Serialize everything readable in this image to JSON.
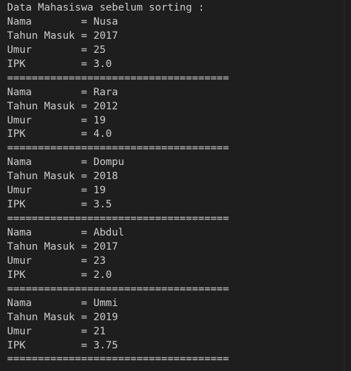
{
  "terminal": {
    "header": "Data Mahasiswa sebelum sorting :",
    "separator": "====================================",
    "labels": {
      "nama": "Nama        = ",
      "tahun": "Tahun Masuk = ",
      "umur": "Umur        = ",
      "ipk": "IPK         = "
    },
    "records": [
      {
        "nama": "Nusa",
        "tahun": "2017",
        "umur": "25",
        "ipk": "3.0"
      },
      {
        "nama": "Rara",
        "tahun": "2012",
        "umur": "19",
        "ipk": "4.0"
      },
      {
        "nama": "Dompu",
        "tahun": "2018",
        "umur": "19",
        "ipk": "3.5"
      },
      {
        "nama": "Abdul",
        "tahun": "2017",
        "umur": "23",
        "ipk": "2.0"
      },
      {
        "nama": "Ummi",
        "tahun": "2019",
        "umur": "21",
        "ipk": "3.75"
      }
    ],
    "colors": {
      "background": "#1e1e1e",
      "text": "#cccccc"
    }
  }
}
